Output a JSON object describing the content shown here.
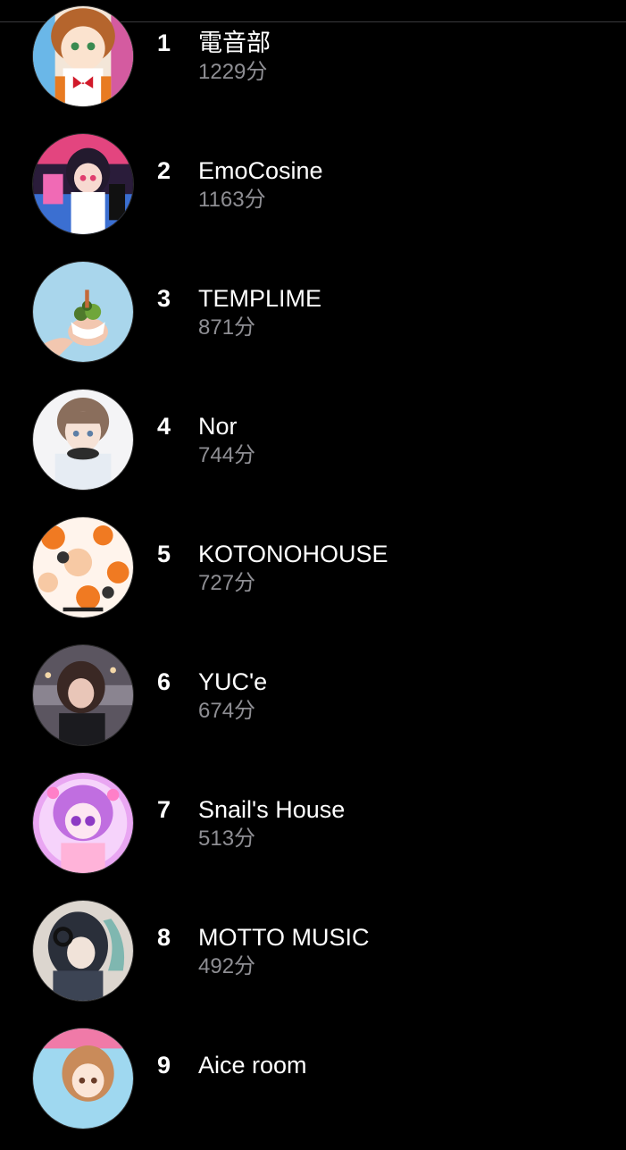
{
  "ranking": [
    {
      "rank": "1",
      "artist": "電音部",
      "minutes": "1229分"
    },
    {
      "rank": "2",
      "artist": "EmoCosine",
      "minutes": "1163分"
    },
    {
      "rank": "3",
      "artist": "TEMPLIME",
      "minutes": "871分"
    },
    {
      "rank": "4",
      "artist": "Nor",
      "minutes": "744分"
    },
    {
      "rank": "5",
      "artist": "KOTONOHOUSE",
      "minutes": "727分"
    },
    {
      "rank": "6",
      "artist": "YUC'e",
      "minutes": "674分"
    },
    {
      "rank": "7",
      "artist": "Snail's House",
      "minutes": "513分"
    },
    {
      "rank": "8",
      "artist": "MOTTO MUSIC",
      "minutes": "492分"
    },
    {
      "rank": "9",
      "artist": "Aice room",
      "minutes": ""
    }
  ],
  "colors": {
    "background": "#000000",
    "primary_text": "#ffffff",
    "secondary_text": "#8e8e93",
    "divider": "#3a3a3c"
  }
}
